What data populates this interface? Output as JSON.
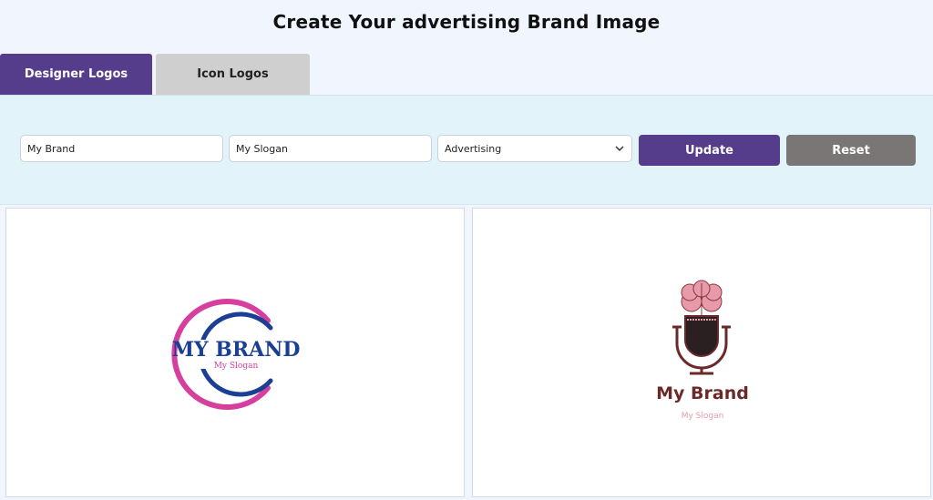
{
  "page": {
    "title": "Create Your advertising Brand Image"
  },
  "tabs": [
    {
      "label": "Designer Logos",
      "active": true
    },
    {
      "label": "Icon Logos",
      "active": false
    }
  ],
  "form": {
    "brand_value": "My Brand",
    "slogan_value": "My Slogan",
    "category_selected": "Advertising",
    "update_label": "Update",
    "reset_label": "Reset"
  },
  "logos": [
    {
      "brand": "MY BRAND",
      "slogan": "My Slogan",
      "icon": "swoosh-ring-icon",
      "brand_color": "#1b3f94",
      "accent_color": "#d63f9d"
    },
    {
      "brand": "My Brand",
      "slogan": "My Slogan",
      "icon": "brain-microphone-icon",
      "brand_color": "#6b2a2a",
      "accent_color": "#e69aaa"
    }
  ],
  "colors": {
    "primary": "#563d8c",
    "reset": "#7a7675",
    "panel": "#e2f3fa",
    "page_bg": "#f1f6fe"
  }
}
